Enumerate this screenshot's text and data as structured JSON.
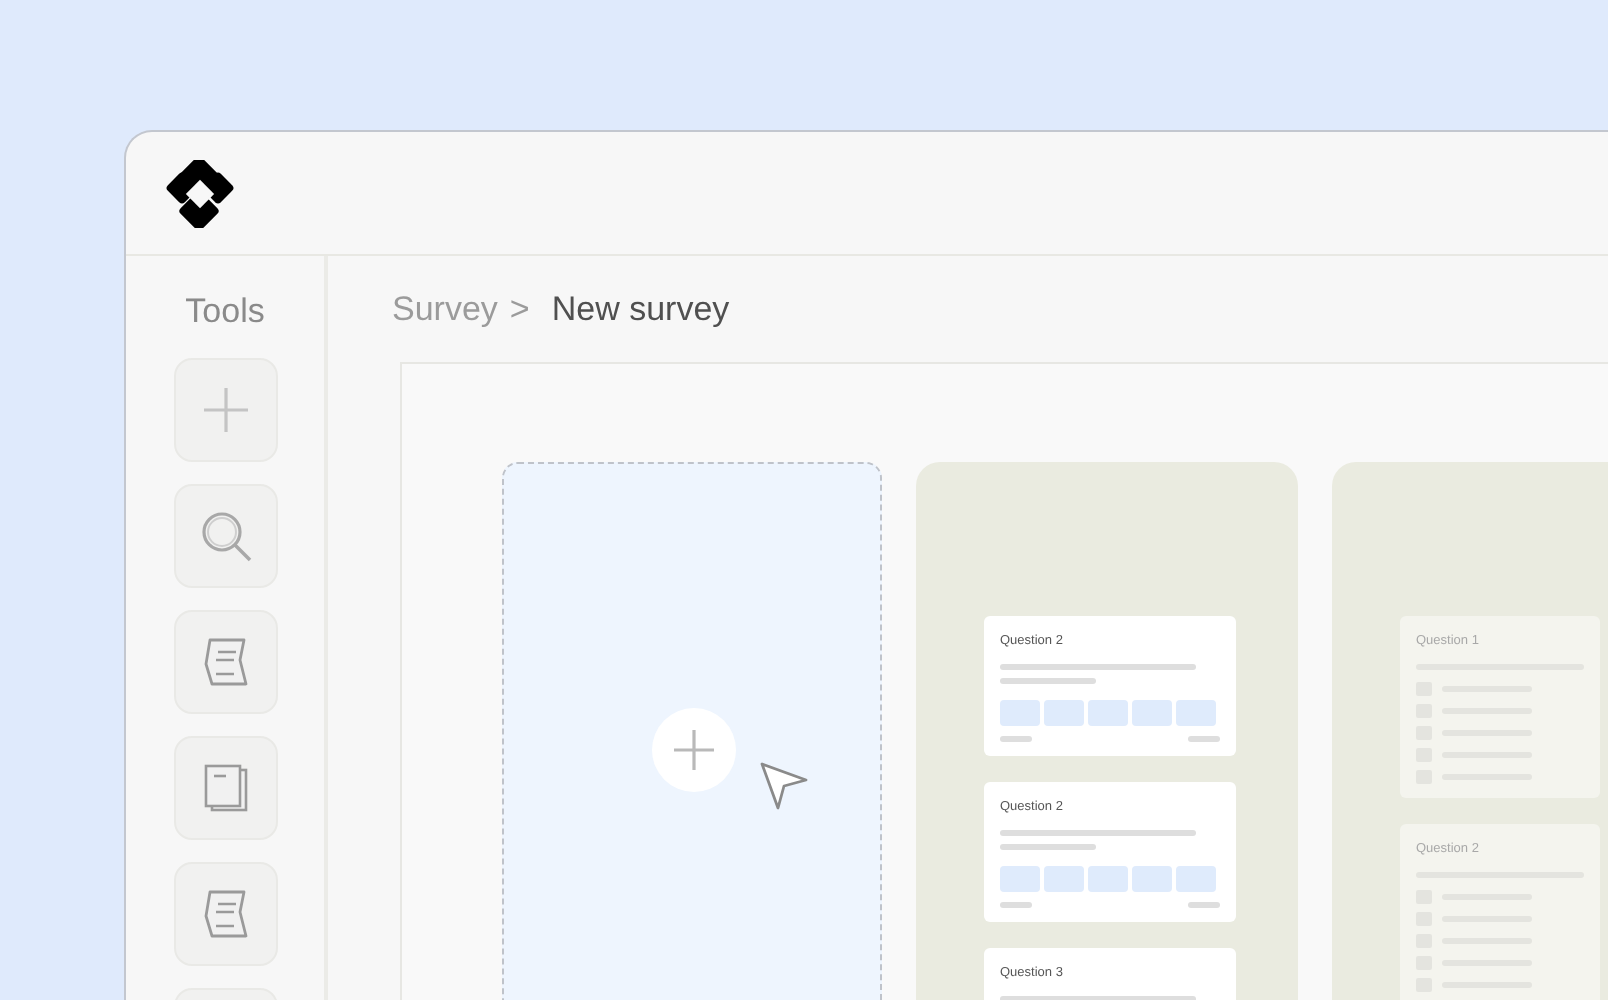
{
  "sidebar": {
    "title": "Tools",
    "tools": [
      {
        "kind": "plus"
      },
      {
        "kind": "search"
      },
      {
        "kind": "note"
      },
      {
        "kind": "pages"
      },
      {
        "kind": "note"
      },
      {
        "kind": "blank"
      }
    ]
  },
  "breadcrumb": {
    "parent": "Survey",
    "separator": ">",
    "current": "New survey"
  },
  "canvas": {
    "dropzone": {
      "kind": "add"
    },
    "columns": [
      {
        "disabled": false,
        "cards": [
          {
            "title": "Question 2",
            "kind": "scale"
          },
          {
            "title": "Question 2",
            "kind": "scale"
          },
          {
            "title": "Question 3",
            "kind": "scale"
          }
        ]
      },
      {
        "disabled": true,
        "cards": [
          {
            "title": "Question 1",
            "kind": "choice"
          },
          {
            "title": "Question 2",
            "kind": "choice"
          }
        ]
      }
    ]
  }
}
